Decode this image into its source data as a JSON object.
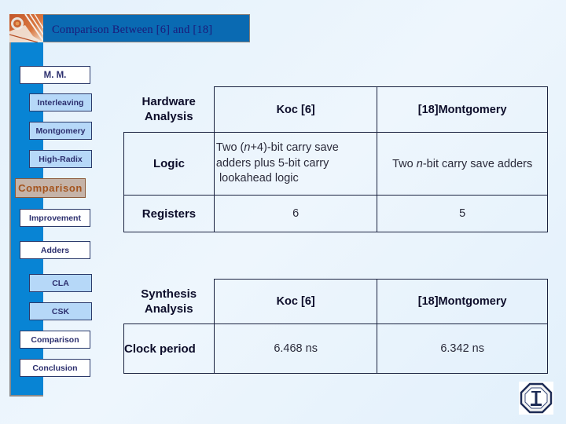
{
  "header": {
    "title": "Comparison Between [6] and [18]",
    "accent_color": "#0a6ab2",
    "title_color": "#1b1a7a"
  },
  "sidebar": {
    "items": [
      {
        "label": "M. M.",
        "level": "main",
        "active": false
      },
      {
        "label": "Interleaving",
        "level": "sub",
        "active": false
      },
      {
        "label": "Montgomery",
        "level": "sub",
        "active": false
      },
      {
        "label": "High-Radix",
        "level": "sub",
        "active": false
      },
      {
        "label": "Comparison",
        "level": "main",
        "active": true
      },
      {
        "label": "Improvement",
        "level": "main",
        "active": false
      },
      {
        "label": "Adders",
        "level": "main",
        "active": false
      },
      {
        "label": "CLA",
        "level": "sub",
        "active": false
      },
      {
        "label": "CSK",
        "level": "sub",
        "active": false
      },
      {
        "label": "Comparison",
        "level": "main",
        "active": false
      },
      {
        "label": "Conclusion",
        "level": "main",
        "active": false
      }
    ],
    "active_color": "#a4541e"
  },
  "hardware_table": {
    "corner": "Hardware Analysis",
    "columns": [
      "Koc [6]",
      "[18]Montgomery"
    ],
    "rows": [
      {
        "label": "Logic",
        "values": [
          "Two (n+4)-bit carry save adders plus 5-bit carry lookahead logic",
          "Two n-bit carry save adders"
        ]
      },
      {
        "label": "Registers",
        "values": [
          "6",
          "5"
        ]
      }
    ],
    "logic_koc_lines": [
      "Two (",
      "n",
      "+4)-bit carry save",
      "adders plus 5-bit carry",
      "lookahead logic"
    ],
    "logic_mont_parts": [
      "Two ",
      "n",
      "-bit carry save adders"
    ]
  },
  "synthesis_table": {
    "corner": "Synthesis Analysis",
    "columns": [
      "Koc [6]",
      "[18]Montgomery"
    ],
    "rows": [
      {
        "label": "Clock period",
        "values": [
          "6.468 ns",
          "6.342 ns"
        ]
      }
    ]
  },
  "logos": {
    "top_left": "university-emblem-icon",
    "bottom_right": "university-seal-icon"
  }
}
